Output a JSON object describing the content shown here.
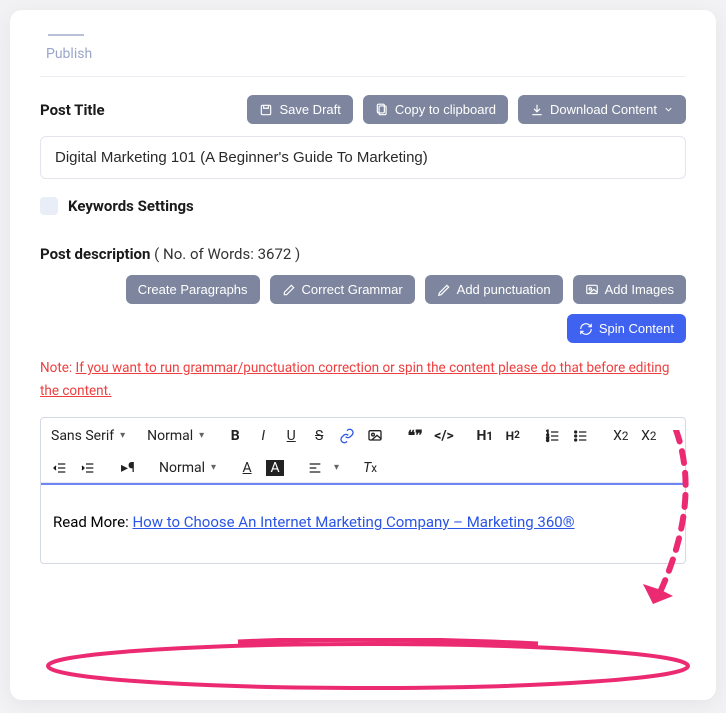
{
  "tab": {
    "label": "Publish"
  },
  "postTitle": {
    "label": "Post Title",
    "value": "Digital Marketing 101 (A Beginner's Guide To Marketing)"
  },
  "buttons": {
    "saveDraft": "Save Draft",
    "copyClipboard": "Copy to clipboard",
    "downloadContent": "Download Content",
    "createParagraphs": "Create Paragraphs",
    "correctGrammar": "Correct Grammar",
    "addPunctuation": "Add punctuation",
    "addImages": "Add Images",
    "spinContent": "Spin Content"
  },
  "keywords": {
    "label": "Keywords Settings"
  },
  "postDescription": {
    "label": "Post description",
    "wordPrefix": "( No. of Words: ",
    "wordCount": "3672",
    "wordSuffix": " )"
  },
  "note": {
    "prefix": "Note: ",
    "body": "If you want to run grammar/punctuation correction or spin the content please do that before editing the content."
  },
  "toolbar": {
    "font": "Sans Serif",
    "size": "Normal",
    "heading": "Normal"
  },
  "content": {
    "readMoreLabel": "Read More: ",
    "link": "How to Choose An Internet Marketing Company – Marketing 360®"
  },
  "colors": {
    "accent": "#3f62f0",
    "grayBtn": "#7d869e",
    "danger": "#ef3e3e",
    "annot": "#ec2a72"
  }
}
